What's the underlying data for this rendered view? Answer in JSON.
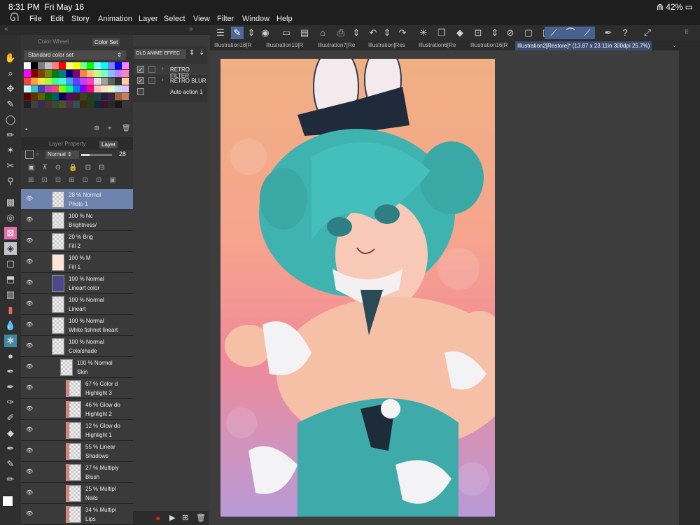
{
  "status": {
    "time": "8:31 PM",
    "date": "Fri May 16",
    "wifi": "wifi-icon",
    "battery": "42%"
  },
  "menu": [
    "File",
    "Edit",
    "Story",
    "Animation",
    "Layer",
    "Select",
    "View",
    "Filter",
    "Window",
    "Help"
  ],
  "color_panel": {
    "tabs": [
      "Color Wheel",
      "Color Set"
    ],
    "selector": "Standard color set"
  },
  "auto_panel": {
    "selector": "OLD ANIME EFFEC",
    "items": [
      {
        "label": "RETRO FILTER",
        "checked": true
      },
      {
        "label": "RETRO BLUR",
        "checked": true
      },
      {
        "label": "Auto action 1",
        "checked": false
      }
    ]
  },
  "layer_panel": {
    "tabs": [
      "Layer Property",
      "Layer"
    ],
    "blend_mode": "Normal",
    "opacity": "28",
    "layers": [
      {
        "pct": "28 %",
        "mode": "Normal",
        "name": "Photo 1"
      },
      {
        "pct": "100 %",
        "mode": "Nc",
        "name": "Brightness/"
      },
      {
        "pct": "20 %",
        "mode": "Brig",
        "name": "Fill 2"
      },
      {
        "pct": "100 %",
        "mode": "M",
        "name": "Fill 1"
      },
      {
        "pct": "100 %",
        "mode": "Normal",
        "name": "Lineart color"
      },
      {
        "pct": "100 %",
        "mode": "Normal",
        "name": "Lineart"
      },
      {
        "pct": "100 %",
        "mode": "Normal",
        "name": "White fishnet lineart"
      },
      {
        "pct": "100 %",
        "mode": "Normal",
        "name": "Colo/shade"
      },
      {
        "pct": "100 %",
        "mode": "Normal",
        "name": "Skin"
      },
      {
        "pct": "67 %",
        "mode": "Color d",
        "name": "Highlight 3"
      },
      {
        "pct": "46 %",
        "mode": "Glow do",
        "name": "Highlight 2"
      },
      {
        "pct": "12 %",
        "mode": "Glow do",
        "name": "Highlight 1"
      },
      {
        "pct": "55 %",
        "mode": "Linear",
        "name": "Shadows"
      },
      {
        "pct": "27 %",
        "mode": "Multiply",
        "name": "Blush"
      },
      {
        "pct": "25 %",
        "mode": "Multipl",
        "name": "Nails"
      },
      {
        "pct": "34 %",
        "mode": "Multipl",
        "name": "Lips"
      }
    ]
  },
  "doc_tabs": [
    "Illustration18[R",
    "Illustration19[R",
    "Illustration7[Re",
    "Illustration[Res",
    "Illustration6[Re",
    "Illustration16[R",
    "Illustration2[Restore]* (13.87 x 23.11in 300dpi 25.7%)"
  ]
}
